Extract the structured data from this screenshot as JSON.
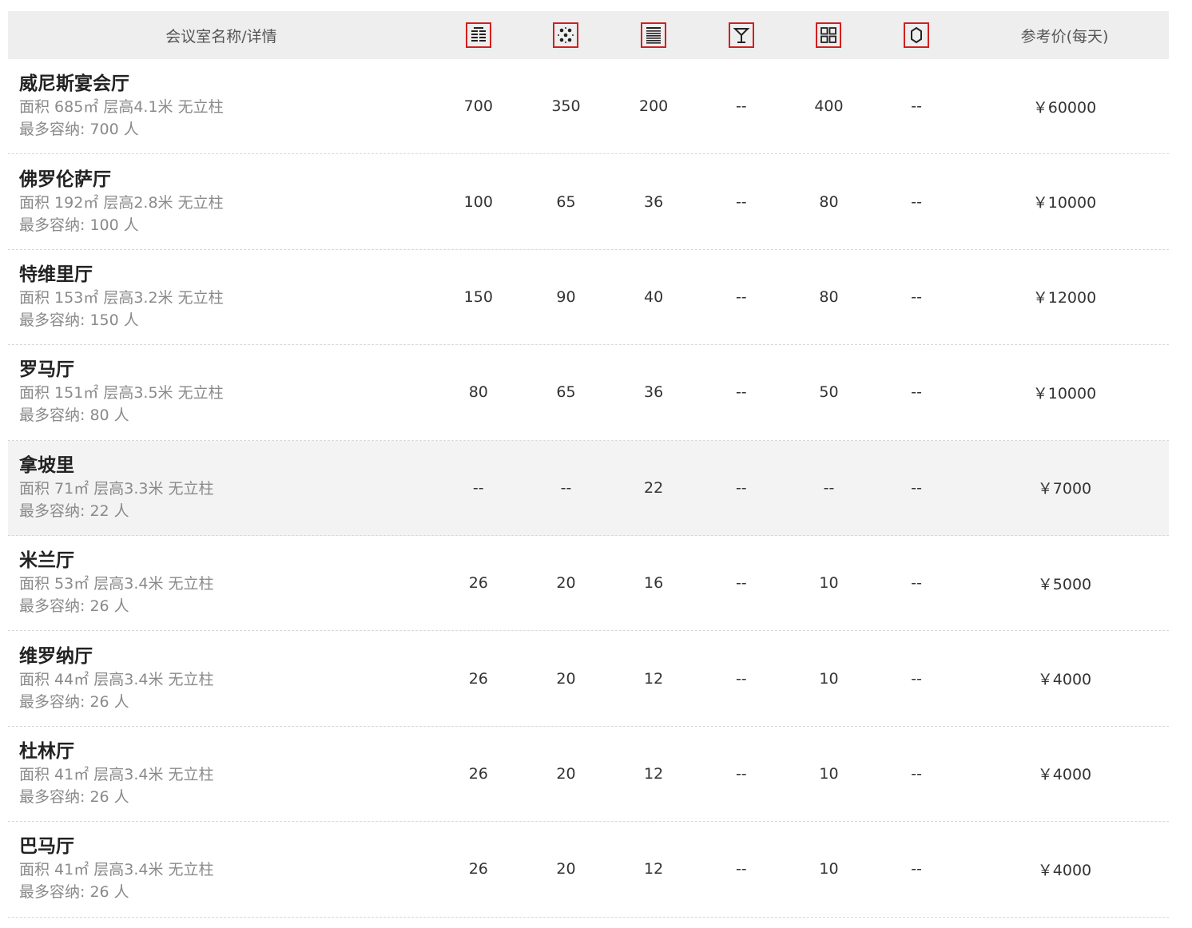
{
  "header": {
    "name_label": "会议室名称/详情",
    "price_label": "参考价(每天)",
    "icons": [
      "theater-layout-icon",
      "banquet-layout-icon",
      "classroom-layout-icon",
      "cocktail-layout-icon",
      "u-shape-layout-icon",
      "boardroom-layout-icon"
    ]
  },
  "colors": {
    "accent": "#d11f1f",
    "header_bg": "#eeeeee",
    "highlight_row_bg": "#f3f3f3"
  },
  "rooms": [
    {
      "name": "威尼斯宴会厅",
      "detail": "面积 685㎡ 层高4.1米 无立柱",
      "capacity": "最多容纳: 700 人",
      "values": [
        "700",
        "350",
        "200",
        "--",
        "400",
        "--"
      ],
      "price": "￥60000"
    },
    {
      "name": "佛罗伦萨厅",
      "detail": "面积 192㎡ 层高2.8米 无立柱",
      "capacity": "最多容纳: 100 人",
      "values": [
        "100",
        "65",
        "36",
        "--",
        "80",
        "--"
      ],
      "price": "￥10000"
    },
    {
      "name": "特维里厅",
      "detail": "面积 153㎡ 层高3.2米 无立柱",
      "capacity": "最多容纳: 150 人",
      "values": [
        "150",
        "90",
        "40",
        "--",
        "80",
        "--"
      ],
      "price": "￥12000"
    },
    {
      "name": "罗马厅",
      "detail": "面积 151㎡ 层高3.5米 无立柱",
      "capacity": "最多容纳: 80 人",
      "values": [
        "80",
        "65",
        "36",
        "--",
        "50",
        "--"
      ],
      "price": "￥10000"
    },
    {
      "name": "拿坡里",
      "detail": "面积 71㎡ 层高3.3米 无立柱",
      "capacity": "最多容纳: 22 人",
      "values": [
        "--",
        "--",
        "22",
        "--",
        "--",
        "--"
      ],
      "price": "￥7000"
    },
    {
      "name": "米兰厅",
      "detail": "面积 53㎡ 层高3.4米 无立柱",
      "capacity": "最多容纳: 26 人",
      "values": [
        "26",
        "20",
        "16",
        "--",
        "10",
        "--"
      ],
      "price": "￥5000"
    },
    {
      "name": "维罗纳厅",
      "detail": "面积 44㎡ 层高3.4米 无立柱",
      "capacity": "最多容纳: 26 人",
      "values": [
        "26",
        "20",
        "12",
        "--",
        "10",
        "--"
      ],
      "price": "￥4000"
    },
    {
      "name": "杜林厅",
      "detail": "面积 41㎡ 层高3.4米 无立柱",
      "capacity": "最多容纳: 26 人",
      "values": [
        "26",
        "20",
        "12",
        "--",
        "10",
        "--"
      ],
      "price": "￥4000"
    },
    {
      "name": "巴马厅",
      "detail": "面积 41㎡ 层高3.4米 无立柱",
      "capacity": "最多容纳: 26 人",
      "values": [
        "26",
        "20",
        "12",
        "--",
        "10",
        "--"
      ],
      "price": "￥4000"
    }
  ]
}
